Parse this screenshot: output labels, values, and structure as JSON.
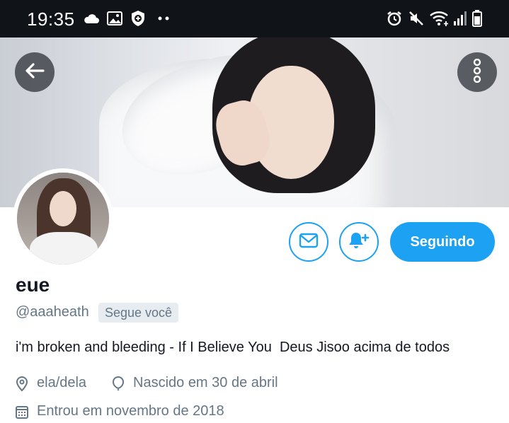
{
  "status_bar": {
    "time": "19:35",
    "left_icons": [
      "cloud-icon",
      "image-icon",
      "shield-icon",
      "more-dots-icon"
    ],
    "right_icons": [
      "alarm-icon",
      "mute-icon",
      "wifi-icon",
      "signal-icon",
      "battery-icon"
    ]
  },
  "header": {
    "back_icon": "arrow-left-icon",
    "more_icon": "more-vertical-icon"
  },
  "profile": {
    "display_name": "eue",
    "handle": "@aaaheath",
    "follows_you_badge": "Segue você",
    "bio": "i'm broken and bleeding - If I Believe You  Deus Jisoo acima de todos",
    "pronouns": "ela/dela",
    "birthday": "Nascido em 30 de abril",
    "joined": "Entrou em novembro de 2018"
  },
  "actions": {
    "message_icon": "envelope-icon",
    "notify_icon": "bell-plus-icon",
    "follow_label": "Seguindo"
  },
  "colors": {
    "accent": "#1da1f2",
    "status_bar_bg": "#101317",
    "secondary_text": "#657786",
    "primary_text": "#141823"
  }
}
